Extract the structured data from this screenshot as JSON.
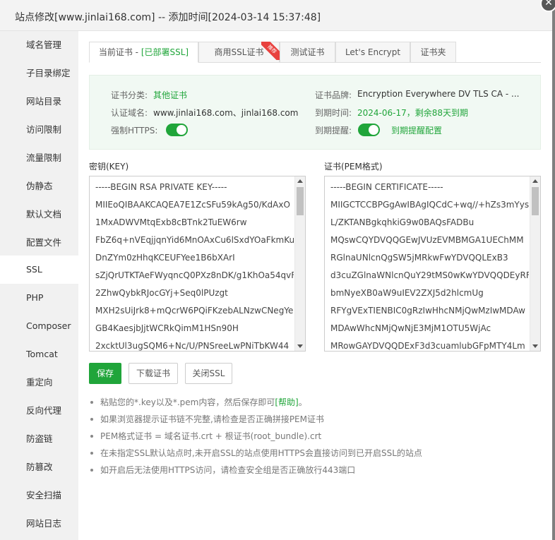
{
  "window": {
    "title": "站点修改[www.jinlai168.com] -- 添加时间[2024-03-14 15:37:48]",
    "close_glyph": "✕"
  },
  "sidebar": {
    "items": [
      {
        "label": "域名管理"
      },
      {
        "label": "子目录绑定"
      },
      {
        "label": "网站目录"
      },
      {
        "label": "访问限制"
      },
      {
        "label": "流量限制"
      },
      {
        "label": "伪静态"
      },
      {
        "label": "默认文档"
      },
      {
        "label": "配置文件"
      },
      {
        "label": "SSL",
        "active": true
      },
      {
        "label": "PHP"
      },
      {
        "label": "Composer"
      },
      {
        "label": "Tomcat"
      },
      {
        "label": "重定向"
      },
      {
        "label": "反向代理"
      },
      {
        "label": "防盗链"
      },
      {
        "label": "防篡改"
      },
      {
        "label": "安全扫描"
      },
      {
        "label": "网站日志"
      }
    ]
  },
  "tabs": {
    "current_prefix": "当前证书 - ",
    "current_status": "[已部署SSL]",
    "commercial": "商用SSL证书",
    "commercial_badge": "推荐",
    "test": "测试证书",
    "letsencrypt": "Let's Encrypt",
    "folder": "证书夹"
  },
  "info": {
    "category_label": "证书分类:",
    "category_value": "其他证书",
    "brand_label": "证书品牌:",
    "brand_value": "Encryption Everywhere DV TLS CA - ...",
    "domain_label": "认证域名:",
    "domain_value": "www.jinlai168.com、jinlai168.com",
    "expiry_label": "到期时间:",
    "expiry_value": "2024-06-17，剩余88天到期",
    "https_label": "强制HTTPS:",
    "https_on": true,
    "remind_label": "到期提醒:",
    "remind_on": true,
    "remind_link": "到期提醒配置"
  },
  "key": {
    "label": "密钥(KEY)",
    "lines": [
      "-----BEGIN RSA PRIVATE KEY-----",
      "MIIEoQIBAAKCAQEA7E1ZcSFu59kAg50/KdAxO",
      "1MxADWVMtqExb8cBTnk2TuEW6rw",
      "FbZ6q+nVEqjjqnYid6MnOAxCu6lSxdYOaFkmKu",
      "DnZYm0zHhqKCEUFYee1B6bXArI",
      "sZjQrUTKTAeFWyqncQ0PXz8nDK/g1KhOa54qvF",
      "2ZhwQybkRJocGYj+Seq0lPUzgt",
      "MXH2sUiJrk8+mQcrW6PQiFKzebALNzwCNegYe",
      "GB4KaesjbJjtWCRkQimM1HSn90H",
      "2xcktUl3ugSQM6+Nc/U/PNSreeLwPNiTbKW44"
    ]
  },
  "cert": {
    "label": "证书(PEM格式)",
    "lines": [
      "-----BEGIN CERTIFICATE-----",
      "MIIGCTCCBPGgAwIBAgIQCdC+wq//+hZs3mYys",
      "L/ZKTANBgkqhkiG9w0BAQsFADBu",
      "MQswCQYDVQQGEwJVUzEVMBMGA1UEChMM",
      "RGlnaUNlcnQgSW5jMRkwFwYDVQQLExB3",
      "d3cuZGlnaWNlcnQuY29tMS0wKwYDVQQDEyRF",
      "bmNyeXB0aW9uIEV2ZXJ5d2hlcmUg",
      "RFYgVExTIENBIC0gRzIwHhcNMjQwMzIwMDAw",
      "MDAwWhcNMjQwNjE3MjM1OTU5WjAc",
      "MRowGAYDVQQDExF3d3cuamlubGFpMTY4Lm"
    ]
  },
  "actions": {
    "save": "保存",
    "download": "下载证书",
    "disable": "关闭SSL"
  },
  "tips": [
    {
      "text": "粘贴您的*.key以及*.pem内容，然后保存即可",
      "link": "[帮助]",
      "suffix": "。"
    },
    {
      "text": "如果浏览器提示证书链不完整,请检查是否正确拼接PEM证书"
    },
    {
      "text": "PEM格式证书 = 域名证书.crt + 根证书(root_bundle).crt"
    },
    {
      "text": "在未指定SSL默认站点时,未开启SSL的站点使用HTTPS会直接访问到已开启SSL的站点"
    },
    {
      "text": "如开启后无法使用HTTPS访问，请检查安全组是否正确放行443端口"
    }
  ]
}
